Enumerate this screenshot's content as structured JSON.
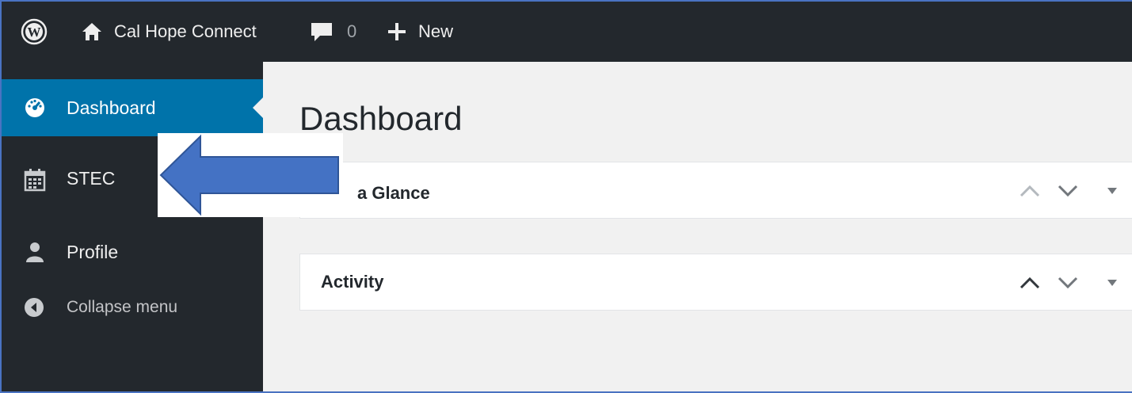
{
  "adminbar": {
    "wp_logo_icon": "wordpress-logo-icon",
    "site_icon": "home-icon",
    "site_name": "Cal Hope Connect",
    "comments_icon": "comment-bubble-icon",
    "comments_count": "0",
    "new_icon": "plus-icon",
    "new_label": "New"
  },
  "sidebar": {
    "items": [
      {
        "label": "Dashboard",
        "icon": "dashboard-gauge-icon",
        "current": true
      },
      {
        "label": "STEC",
        "icon": "calendar-icon",
        "current": false
      },
      {
        "label": "Profile",
        "icon": "user-icon",
        "current": false
      },
      {
        "label": "Collapse menu",
        "icon": "collapse-arrow-icon",
        "current": false
      }
    ]
  },
  "main": {
    "title": "Dashboard",
    "widgets": [
      {
        "title": "a Glance"
      },
      {
        "title": "Activity"
      }
    ]
  },
  "annotation": {
    "type": "arrow",
    "direction": "left",
    "fill": "#4472c4",
    "stroke": "#2f5597"
  },
  "colors": {
    "adminbar_bg": "#23282d",
    "sidebar_bg": "#23282d",
    "current_item_bg": "#0073aa",
    "content_bg": "#f1f1f1",
    "frame_border": "#4a73c2"
  }
}
